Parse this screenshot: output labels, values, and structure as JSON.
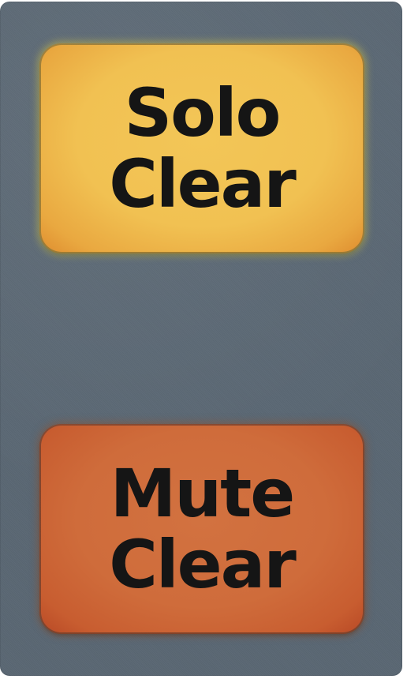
{
  "buttons": {
    "solo_clear": {
      "line1": "Solo",
      "line2": "Clear",
      "color": "#f1c152"
    },
    "mute_clear": {
      "line1": "Mute",
      "line2": "Clear",
      "color": "#cf6c3b"
    }
  },
  "panel": {
    "background": "#5a6773"
  }
}
